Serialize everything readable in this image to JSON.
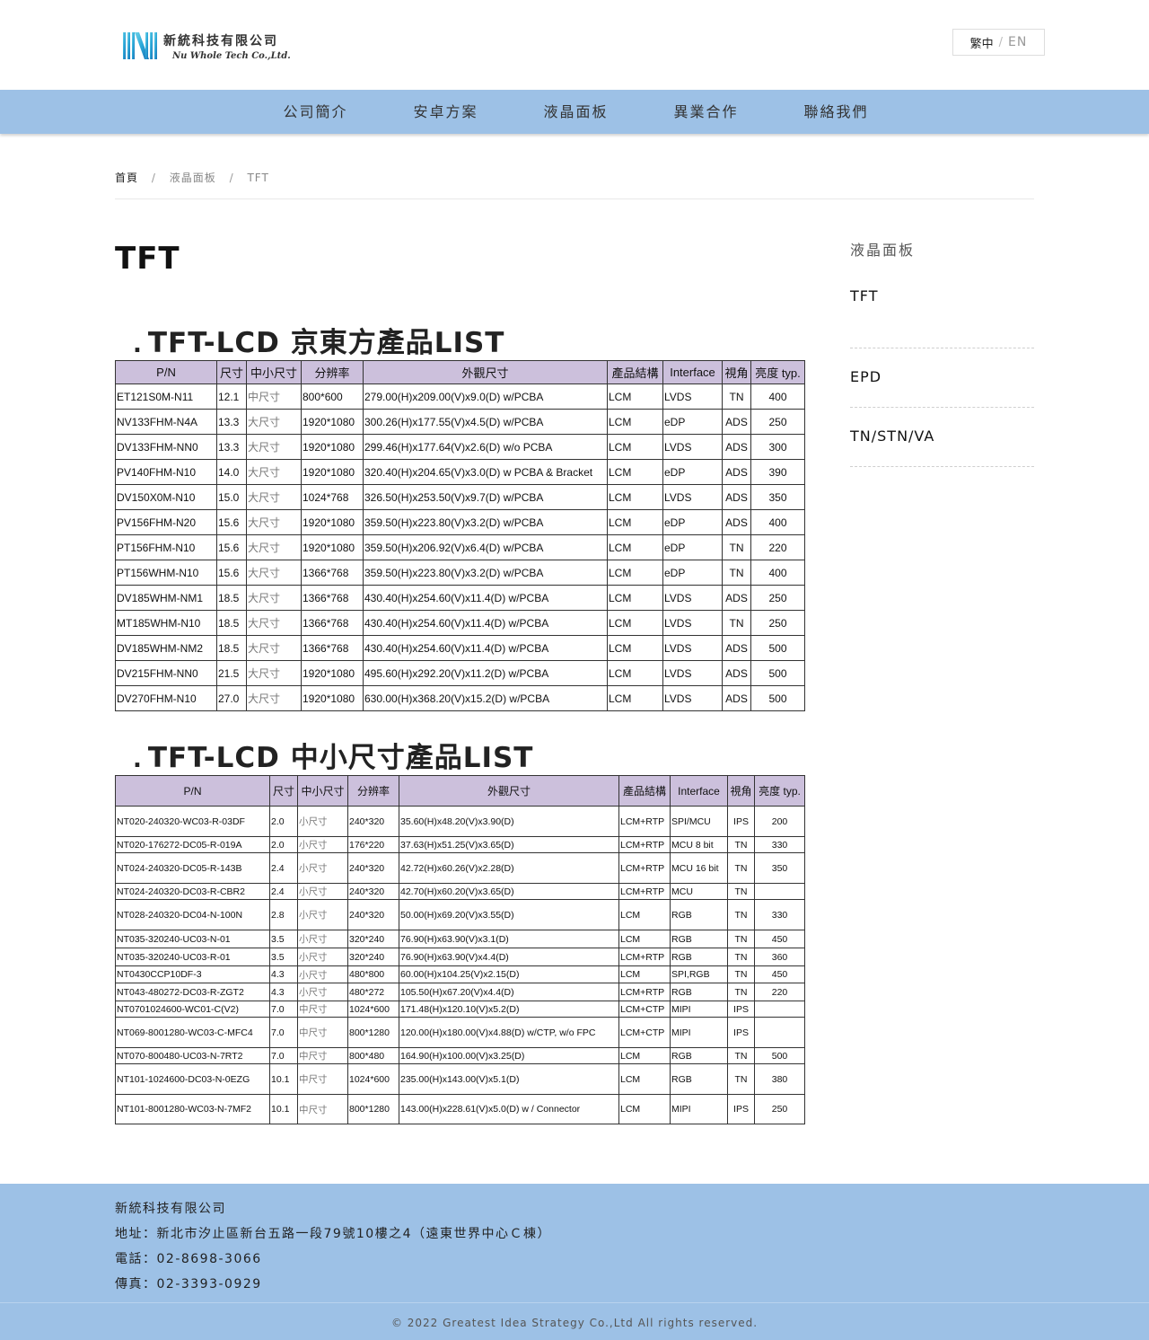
{
  "brand": {
    "name_zh": "新統科技有限公司",
    "name_en": "Nu Whole Tech Co.,Ltd.",
    "logo_icon": "nu-logo-icon",
    "logo_colors": [
      "#2aa7d8",
      "#6fd3e8",
      "#1b6fb3"
    ]
  },
  "lang": {
    "zh": "繁中",
    "sep": "/",
    "en": "EN"
  },
  "nav": {
    "items": [
      {
        "label": "公司簡介"
      },
      {
        "label": "安卓方案"
      },
      {
        "label": "液晶面板"
      },
      {
        "label": "異業合作"
      },
      {
        "label": "聯絡我們"
      }
    ]
  },
  "breadcrumb": {
    "home": "首頁",
    "parent": "液晶面板",
    "current": "TFT",
    "sep": "/"
  },
  "page": {
    "title": "TFT"
  },
  "sidebar": {
    "heading": "液晶面板",
    "items": [
      {
        "label": "TFT"
      },
      {
        "label": "EPD"
      },
      {
        "label": "TN/STN/VA"
      }
    ]
  },
  "section1": {
    "bullet": ".",
    "title": "TFT-LCD 京東方產品LIST",
    "headers": [
      "P/N",
      "尺寸",
      "中小尺寸",
      "分辨率",
      "外觀尺寸",
      "產品結構",
      "Interface",
      "視角",
      "亮度 typ."
    ],
    "rows": [
      [
        "ET121S0M-N11",
        "12.1",
        "中尺寸",
        "800*600",
        "279.00(H)x209.00(V)x9.0(D) w/PCBA",
        "LCM",
        "LVDS",
        "TN",
        "400"
      ],
      [
        "NV133FHM-N4A",
        "13.3",
        "大尺寸",
        "1920*1080",
        "300.26(H)x177.55(V)x4.5(D) w/PCBA",
        "LCM",
        "eDP",
        "ADS",
        "250"
      ],
      [
        "DV133FHM-NN0",
        "13.3",
        "大尺寸",
        "1920*1080",
        "299.46(H)x177.64(V)x2.6(D) w/o PCBA",
        "LCM",
        "LVDS",
        "ADS",
        "300"
      ],
      [
        "PV140FHM-N10",
        "14.0",
        "大尺寸",
        "1920*1080",
        "320.40(H)x204.65(V)x3.0(D) w PCBA & Bracket",
        "LCM",
        "eDP",
        "ADS",
        "390"
      ],
      [
        "DV150X0M-N10",
        "15.0",
        "大尺寸",
        "1024*768",
        "326.50(H)x253.50(V)x9.7(D) w/PCBA",
        "LCM",
        "LVDS",
        "ADS",
        "350"
      ],
      [
        "PV156FHM-N20",
        "15.6",
        "大尺寸",
        "1920*1080",
        "359.50(H)x223.80(V)x3.2(D) w/PCBA",
        "LCM",
        "eDP",
        "ADS",
        "400"
      ],
      [
        "PT156FHM-N10",
        "15.6",
        "大尺寸",
        "1920*1080",
        "359.50(H)x206.92(V)x6.4(D) w/PCBA",
        "LCM",
        "eDP",
        "TN",
        "220"
      ],
      [
        "PT156WHM-N10",
        "15.6",
        "大尺寸",
        "1366*768",
        "359.50(H)x223.80(V)x3.2(D) w/PCBA",
        "LCM",
        "eDP",
        "TN",
        "400"
      ],
      [
        "DV185WHM-NM1",
        "18.5",
        "大尺寸",
        "1366*768",
        "430.40(H)x254.60(V)x11.4(D) w/PCBA",
        "LCM",
        "LVDS",
        "ADS",
        "250"
      ],
      [
        "MT185WHM-N10",
        "18.5",
        "大尺寸",
        "1366*768",
        "430.40(H)x254.60(V)x11.4(D) w/PCBA",
        "LCM",
        "LVDS",
        "TN",
        "250"
      ],
      [
        "DV185WHM-NM2",
        "18.5",
        "大尺寸",
        "1366*768",
        "430.40(H)x254.60(V)x11.4(D) w/PCBA",
        "LCM",
        "LVDS",
        "ADS",
        "500"
      ],
      [
        "DV215FHM-NN0",
        "21.5",
        "大尺寸",
        "1920*1080",
        "495.60(H)x292.20(V)x11.2(D) w/PCBA",
        "LCM",
        "LVDS",
        "ADS",
        "500"
      ],
      [
        "DV270FHM-N10",
        "27.0",
        "大尺寸",
        "1920*1080",
        "630.00(H)x368.20(V)x15.2(D) w/PCBA",
        "LCM",
        "LVDS",
        "ADS",
        "500"
      ]
    ]
  },
  "section2": {
    "bullet": ".",
    "title": "TFT-LCD 中小尺寸產品LIST",
    "headers": [
      "P/N",
      "尺寸",
      "中小尺寸",
      "分辨率",
      "外觀尺寸",
      "產品結構",
      "Interface",
      "視角",
      "亮度 typ."
    ],
    "rows": [
      [
        "NT020-240320-WC03-R-03DF",
        "2.0",
        "小尺寸",
        "240*320",
        "35.60(H)x48.20(V)x3.90(D)",
        "LCM+RTP",
        "SPI/MCU",
        "IPS",
        "200"
      ],
      [
        "NT020-176272-DC05-R-019A",
        "2.0",
        "小尺寸",
        "176*220",
        "37.63(H)x51.25(V)x3.65(D)",
        "LCM+RTP",
        "MCU 8 bit",
        "TN",
        "330"
      ],
      [
        "NT024-240320-DC05-R-143B",
        "2.4",
        "小尺寸",
        "240*320",
        "42.72(H)x60.26(V)x2.28(D)",
        "LCM+RTP",
        "MCU 16 bit",
        "TN",
        "350"
      ],
      [
        "NT024-240320-DC03-R-CBR2",
        "2.4",
        "小尺寸",
        "240*320",
        "42.70(H)x60.20(V)x3.65(D)",
        "LCM+RTP",
        "MCU",
        "TN",
        ""
      ],
      [
        "NT028-240320-DC04-N-100N",
        "2.8",
        "小尺寸",
        "240*320",
        "50.00(H)x69.20(V)x3.55(D)",
        "LCM",
        "RGB",
        "TN",
        "330"
      ],
      [
        "NT035-320240-UC03-N-01",
        "3.5",
        "小尺寸",
        "320*240",
        "76.90(H)x63.90(V)x3.1(D)",
        "LCM",
        "RGB",
        "TN",
        "450"
      ],
      [
        "NT035-320240-UC03-R-01",
        "3.5",
        "小尺寸",
        "320*240",
        "76.90(H)x63.90(V)x4.4(D)",
        "LCM+RTP",
        "RGB",
        "TN",
        "360"
      ],
      [
        "NT0430CCP10DF-3",
        "4.3",
        "小尺寸",
        "480*800",
        "60.00(H)x104.25(V)x2.15(D)",
        "LCM",
        "SPI,RGB",
        "TN",
        "450"
      ],
      [
        "NT043-480272-DC03-R-ZGT2",
        "4.3",
        "小尺寸",
        "480*272",
        "105.50(H)x67.20(V)x4.4(D)",
        "LCM+RTP",
        "RGB",
        "TN",
        "220"
      ],
      [
        "NT0701024600-WC01-C(V2)",
        "7.0",
        "中尺寸",
        "1024*600",
        "171.48(H)x120.10(V)x5.2(D)",
        "LCM+CTP",
        "MIPI",
        "IPS",
        ""
      ],
      [
        "NT069-8001280-WC03-C-MFC4",
        "7.0",
        "中尺寸",
        "800*1280",
        "120.00(H)x180.00(V)x4.88(D) w/CTP, w/o FPC",
        "LCM+CTP",
        "MIPI",
        "IPS",
        ""
      ],
      [
        "NT070-800480-UC03-N-7RT2",
        "7.0",
        "中尺寸",
        "800*480",
        "164.90(H)x100.00(V)x3.25(D)",
        "LCM",
        "RGB",
        "TN",
        "500"
      ],
      [
        "NT101-1024600-DC03-N-0EZG",
        "10.1",
        "中尺寸",
        "1024*600",
        "235.00(H)x143.00(V)x5.1(D)",
        "LCM",
        "RGB",
        "TN",
        "380"
      ],
      [
        "NT101-8001280-WC03-N-7MF2",
        "10.1",
        "中尺寸",
        "800*1280",
        "143.00(H)x228.61(V)x5.0(D) w / Connector",
        "LCM",
        "MIPI",
        "IPS",
        "250"
      ]
    ]
  },
  "footer": {
    "company": "新統科技有限公司",
    "address": "地址：新北市汐止區新台五路一段79號10樓之4（遠東世界中心Ｃ棟）",
    "phone": "電話：02-8698-3066",
    "fax": "傳真：02-3393-0929",
    "copyright": "© 2022 Greatest Idea Strategy Co.,Ltd All rights reserved."
  }
}
